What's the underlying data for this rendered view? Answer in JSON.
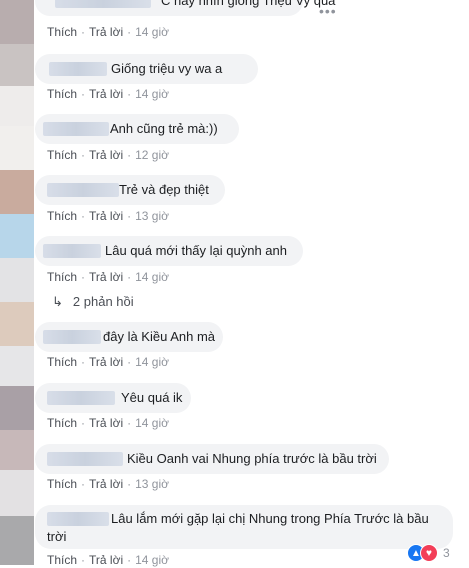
{
  "comments": [
    {
      "text": "C này nhìn giống Triệu Vy quá",
      "actions": {
        "like": "Thích",
        "reply": "Trả lời",
        "time": "14 giờ"
      }
    },
    {
      "text": "Giống triệu vy wa a",
      "actions": {
        "like": "Thích",
        "reply": "Trả lời",
        "time": "14 giờ"
      }
    },
    {
      "text": "Anh cũng trẻ mà:))",
      "actions": {
        "like": "Thích",
        "reply": "Trả lời",
        "time": "12 giờ"
      }
    },
    {
      "text": "Trẻ và đẹp thiệt",
      "actions": {
        "like": "Thích",
        "reply": "Trả lời",
        "time": "13 giờ"
      }
    },
    {
      "text": "Lâu quá mới thấy lại quỳnh anh",
      "actions": {
        "like": "Thích",
        "reply": "Trả lời",
        "time": "14 giờ"
      }
    },
    {
      "text": "đây là Kiều Anh mà",
      "actions": {
        "like": "Thích",
        "reply": "Trả lời",
        "time": "14 giờ"
      }
    },
    {
      "text": "Yêu quá ik",
      "actions": {
        "like": "Thích",
        "reply": "Trả lời",
        "time": "14 giờ"
      }
    },
    {
      "text": "Kiều Oanh vai Nhung phía trước là bầu trời",
      "actions": {
        "like": "Thích",
        "reply": "Trả lời",
        "time": "13 giờ"
      }
    },
    {
      "text_line1": "Lâu lắm mới gặp lại chị Nhung trong Phía Trước là bầu",
      "text_line2": "trời",
      "actions": {
        "like": "Thích",
        "reply": "Trả lời",
        "time": "14 giờ"
      }
    }
  ],
  "replies_link": "2 phản hồi",
  "reaction_count": "3",
  "icons": {
    "more": "more-options-icon",
    "reply_arrow": "reply-arrow-icon",
    "like": "like-reaction-icon",
    "love": "love-reaction-icon"
  }
}
